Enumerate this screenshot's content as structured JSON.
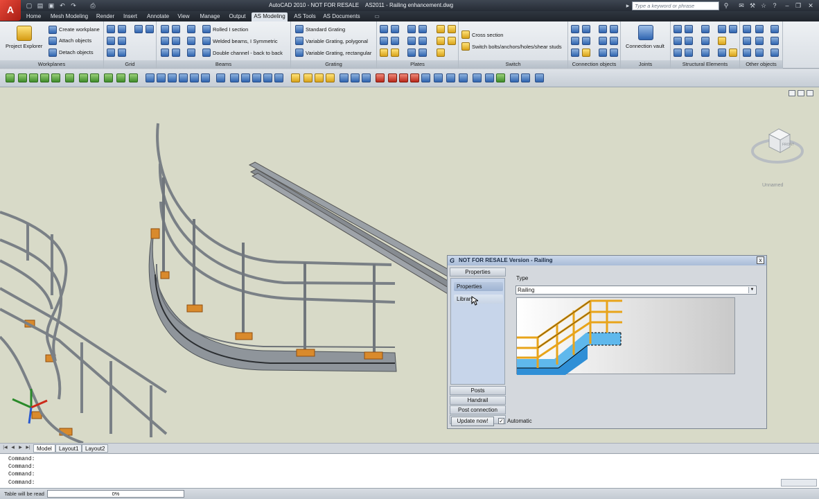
{
  "app": {
    "logo": "A",
    "title": "AutoCAD 2010 - NOT FOR RESALE",
    "file": "AS2011 - Railing enhancement.dwg",
    "search_placeholder": "Type a keyword or phrase"
  },
  "menu_tabs": [
    "Home",
    "Mesh Modeling",
    "Render",
    "Insert",
    "Annotate",
    "View",
    "Manage",
    "Output",
    "AS Modeling",
    "AS Tools",
    "AS Documents"
  ],
  "ribbon": {
    "workplanes": {
      "label": "Workplanes",
      "big": "Project Explorer",
      "items": [
        "Create workplane",
        "Attach objects",
        "Detach objects"
      ]
    },
    "grid": {
      "label": "Grid"
    },
    "beams": {
      "label": "Beams",
      "items": [
        "Rolled I section",
        "Welded beams, I Symmetric",
        "Double channel - back to back"
      ]
    },
    "grating": {
      "label": "Grating",
      "items": [
        "Standard Grating",
        "Variable Grating, polygonal",
        "Variable Grating, rectangular"
      ]
    },
    "plates": {
      "label": "Plates"
    },
    "switch": {
      "label": "Switch",
      "items": [
        "Cross section",
        "Switch bolts/anchors/holes/shear studs"
      ]
    },
    "connection_objects": {
      "label": "Connection objects"
    },
    "joints": {
      "label": "Joints",
      "big": "Connection vault"
    },
    "structural": {
      "label": "Structural Elements"
    },
    "other": {
      "label": "Other objects"
    }
  },
  "viewport": {
    "view_name": "Unnamed",
    "cube_face": "FRONT"
  },
  "dialog": {
    "logo": "G",
    "title": "NOT FOR RESALE Version - Railing",
    "close": "x",
    "categories_top": "Properties",
    "sub_items": [
      "Properties",
      "Library"
    ],
    "categories_bottom": [
      "Posts",
      "Handrail",
      "Post connection",
      "Hang off rail"
    ],
    "type_label": "Type",
    "type_value": "Railing",
    "update_button": "Update now!",
    "automatic_label": "Automatic",
    "automatic_checked": true,
    "check_mark": "✓"
  },
  "layout_tabs": [
    "Model",
    "Layout1",
    "Layout2"
  ],
  "command_lines": [
    "Command:",
    "Command:",
    "Command:",
    "Command:"
  ],
  "status": {
    "text": "Table will be read",
    "progress": "0%"
  },
  "colors": {
    "accent": "#2f64b0",
    "highlight": "#e08a2a",
    "viewport_bg": "#d8dac8"
  }
}
